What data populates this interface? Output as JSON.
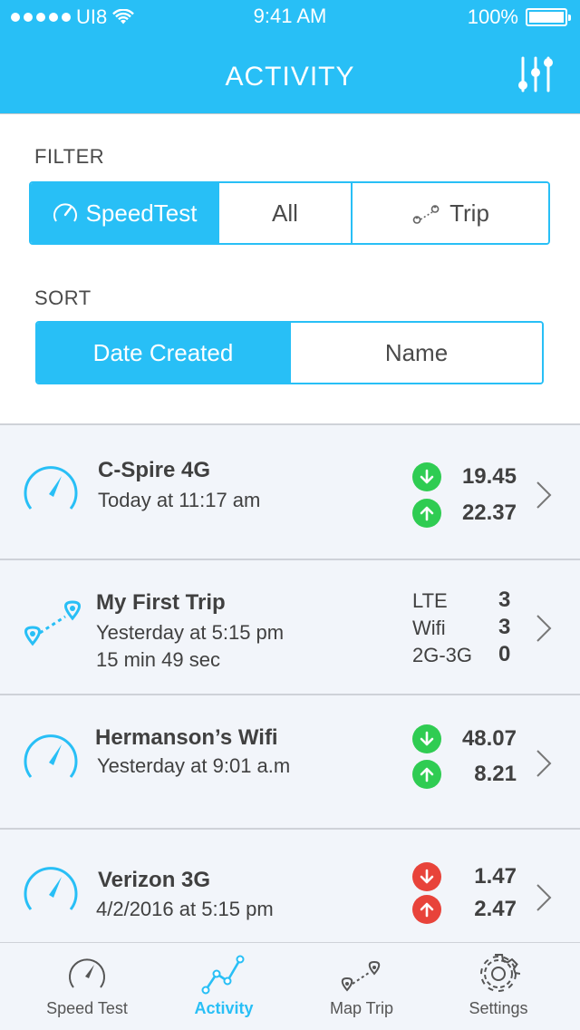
{
  "status": {
    "carrier": "UI8",
    "time": "9:41 AM",
    "battery": "100%"
  },
  "nav": {
    "title": "ACTIVITY"
  },
  "filter": {
    "label": "FILTER",
    "options": [
      {
        "label": "SpeedTest",
        "icon": "speedometer-icon",
        "active": true
      },
      {
        "label": "All",
        "active": false
      },
      {
        "label": "Trip",
        "icon": "trip-icon",
        "active": false
      }
    ]
  },
  "sort": {
    "label": "SORT",
    "options": [
      {
        "label": "Date Created",
        "active": true
      },
      {
        "label": "Name",
        "active": false
      }
    ]
  },
  "list": [
    {
      "type": "speedtest",
      "name": "C-Spire 4G",
      "date": "Today at 11:17 am",
      "download": "19.45",
      "upload": "22.37",
      "status_color": "#2fcc52"
    },
    {
      "type": "trip",
      "name": "My First Trip",
      "date": "Yesterday at 5:15 pm",
      "duration": "15 min 49 sec",
      "stats": [
        {
          "label": "LTE",
          "value": "3"
        },
        {
          "label": "Wifi",
          "value": "3"
        },
        {
          "label": "2G-3G",
          "value": "0"
        }
      ]
    },
    {
      "type": "speedtest",
      "name": "Hermanson’s Wifi",
      "date": "Yesterday at 9:01 a.m",
      "download": "48.07",
      "upload": "8.21",
      "status_color": "#2fcc52"
    },
    {
      "type": "speedtest",
      "name": "Verizon 3G",
      "date": "4/2/2016 at 5:15 pm",
      "download": "1.47",
      "upload": "2.47",
      "status_color": "#e8433a"
    }
  ],
  "tabs": [
    {
      "label": "Speed Test",
      "icon": "speedometer-icon",
      "active": false
    },
    {
      "label": "Activity",
      "icon": "activity-graph-icon",
      "active": true
    },
    {
      "label": "Map Trip",
      "icon": "map-trip-icon",
      "active": false
    },
    {
      "label": "Settings",
      "icon": "gear-icon",
      "active": false
    }
  ],
  "colors": {
    "accent": "#28bff6",
    "good": "#2fcc52",
    "bad": "#e8433a"
  }
}
